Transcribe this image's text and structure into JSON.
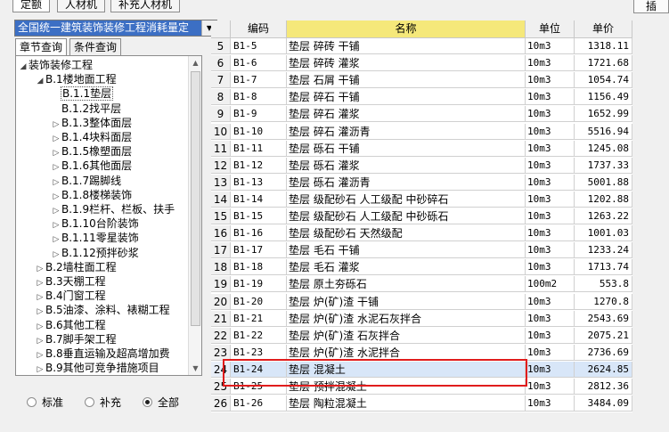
{
  "top_tabs": [
    "定额",
    "人材机",
    "补充人材机"
  ],
  "insert_button": "插",
  "quota_select": {
    "value": "全国统一建筑装饰装修工程消耗量定"
  },
  "sub_tabs": [
    "章节查询",
    "条件查询"
  ],
  "tree": [
    {
      "label": "装饰装修工程",
      "exp": "◢"
    },
    {
      "label": "B.1楼地面工程",
      "exp": "◢"
    },
    {
      "label": "B.1.1垫层",
      "exp": ""
    },
    {
      "label": "B.1.2找平层",
      "exp": ""
    },
    {
      "label": "B.1.3整体面层",
      "exp": "▷"
    },
    {
      "label": "B.1.4块料面层",
      "exp": "▷"
    },
    {
      "label": "B.1.5橡塑面层",
      "exp": "▷"
    },
    {
      "label": "B.1.6其他面层",
      "exp": "▷"
    },
    {
      "label": "B.1.7踢脚线",
      "exp": "▷"
    },
    {
      "label": "B.1.8楼梯装饰",
      "exp": "▷"
    },
    {
      "label": "B.1.9栏杆、栏板、扶手",
      "exp": "▷"
    },
    {
      "label": "B.1.10台阶装饰",
      "exp": "▷"
    },
    {
      "label": "B.1.11零星装饰",
      "exp": "▷"
    },
    {
      "label": "B.1.12预拌砂浆",
      "exp": "▷"
    },
    {
      "label": "B.2墙柱面工程",
      "exp": "▷"
    },
    {
      "label": "B.3天棚工程",
      "exp": "▷"
    },
    {
      "label": "B.4门窗工程",
      "exp": "▷"
    },
    {
      "label": "B.5油漆、涂料、裱糊工程",
      "exp": "▷"
    },
    {
      "label": "B.6其他工程",
      "exp": "▷"
    },
    {
      "label": "B.7脚手架工程",
      "exp": "▷"
    },
    {
      "label": "B.8垂直运输及超高增加费",
      "exp": "▷"
    },
    {
      "label": "B.9其他可竞争措施项目",
      "exp": "▷"
    }
  ],
  "radios": [
    {
      "label": "标准",
      "checked": false
    },
    {
      "label": "补充",
      "checked": false
    },
    {
      "label": "全部",
      "checked": true
    }
  ],
  "table": {
    "headers": {
      "code": "编码",
      "name": "名称",
      "unit": "单位",
      "price": "单价"
    },
    "rows": [
      {
        "num": "5",
        "code": "B1-5",
        "name": "垫层 碎砖 干铺",
        "unit": "10m3",
        "price": "1318.11"
      },
      {
        "num": "6",
        "code": "B1-6",
        "name": "垫层 碎砖 灌浆",
        "unit": "10m3",
        "price": "1721.68"
      },
      {
        "num": "7",
        "code": "B1-7",
        "name": "垫层 石屑 干铺",
        "unit": "10m3",
        "price": "1054.74"
      },
      {
        "num": "8",
        "code": "B1-8",
        "name": "垫层 碎石 干铺",
        "unit": "10m3",
        "price": "1156.49"
      },
      {
        "num": "9",
        "code": "B1-9",
        "name": "垫层 碎石 灌浆",
        "unit": "10m3",
        "price": "1652.99"
      },
      {
        "num": "10",
        "code": "B1-10",
        "name": "垫层 碎石 灌沥青",
        "unit": "10m3",
        "price": "5516.94"
      },
      {
        "num": "11",
        "code": "B1-11",
        "name": "垫层 砾石 干铺",
        "unit": "10m3",
        "price": "1245.08"
      },
      {
        "num": "12",
        "code": "B1-12",
        "name": "垫层 砾石 灌浆",
        "unit": "10m3",
        "price": "1737.33"
      },
      {
        "num": "13",
        "code": "B1-13",
        "name": "垫层 砾石 灌沥青",
        "unit": "10m3",
        "price": "5001.88"
      },
      {
        "num": "14",
        "code": "B1-14",
        "name": "垫层 级配砂石 人工级配 中砂碎石",
        "unit": "10m3",
        "price": "1202.88"
      },
      {
        "num": "15",
        "code": "B1-15",
        "name": "垫层 级配砂石 人工级配 中砂砾石",
        "unit": "10m3",
        "price": "1263.22"
      },
      {
        "num": "16",
        "code": "B1-16",
        "name": "垫层 级配砂石 天然级配",
        "unit": "10m3",
        "price": "1001.03"
      },
      {
        "num": "17",
        "code": "B1-17",
        "name": "垫层 毛石 干铺",
        "unit": "10m3",
        "price": "1233.24"
      },
      {
        "num": "18",
        "code": "B1-18",
        "name": "垫层 毛石 灌浆",
        "unit": "10m3",
        "price": "1713.74"
      },
      {
        "num": "19",
        "code": "B1-19",
        "name": "垫层 原土夯砾石",
        "unit": "100m2",
        "price": "553.8"
      },
      {
        "num": "20",
        "code": "B1-20",
        "name": "垫层 炉(矿)渣 干铺",
        "unit": "10m3",
        "price": "1270.8"
      },
      {
        "num": "21",
        "code": "B1-21",
        "name": "垫层 炉(矿)渣 水泥石灰拌合",
        "unit": "10m3",
        "price": "2543.69"
      },
      {
        "num": "22",
        "code": "B1-22",
        "name": "垫层 炉(矿)渣 石灰拌合",
        "unit": "10m3",
        "price": "2075.21"
      },
      {
        "num": "23",
        "code": "B1-23",
        "name": "垫层 炉(矿)渣 水泥拌合",
        "unit": "10m3",
        "price": "2736.69"
      },
      {
        "num": "24",
        "code": "B1-24",
        "name": "垫层 混凝土",
        "unit": "10m3",
        "price": "2624.85"
      },
      {
        "num": "25",
        "code": "B1-25",
        "name": "垫层 预拌混凝土",
        "unit": "10m3",
        "price": "2812.36"
      },
      {
        "num": "26",
        "code": "B1-26",
        "name": "垫层 陶粒混凝土",
        "unit": "10m3",
        "price": "3484.09"
      }
    ],
    "selected_row": 19
  },
  "colors": {
    "highlight_box": "#e01c1c",
    "name_header": "#f5e87a",
    "select_blue": "#3c6fc4"
  }
}
